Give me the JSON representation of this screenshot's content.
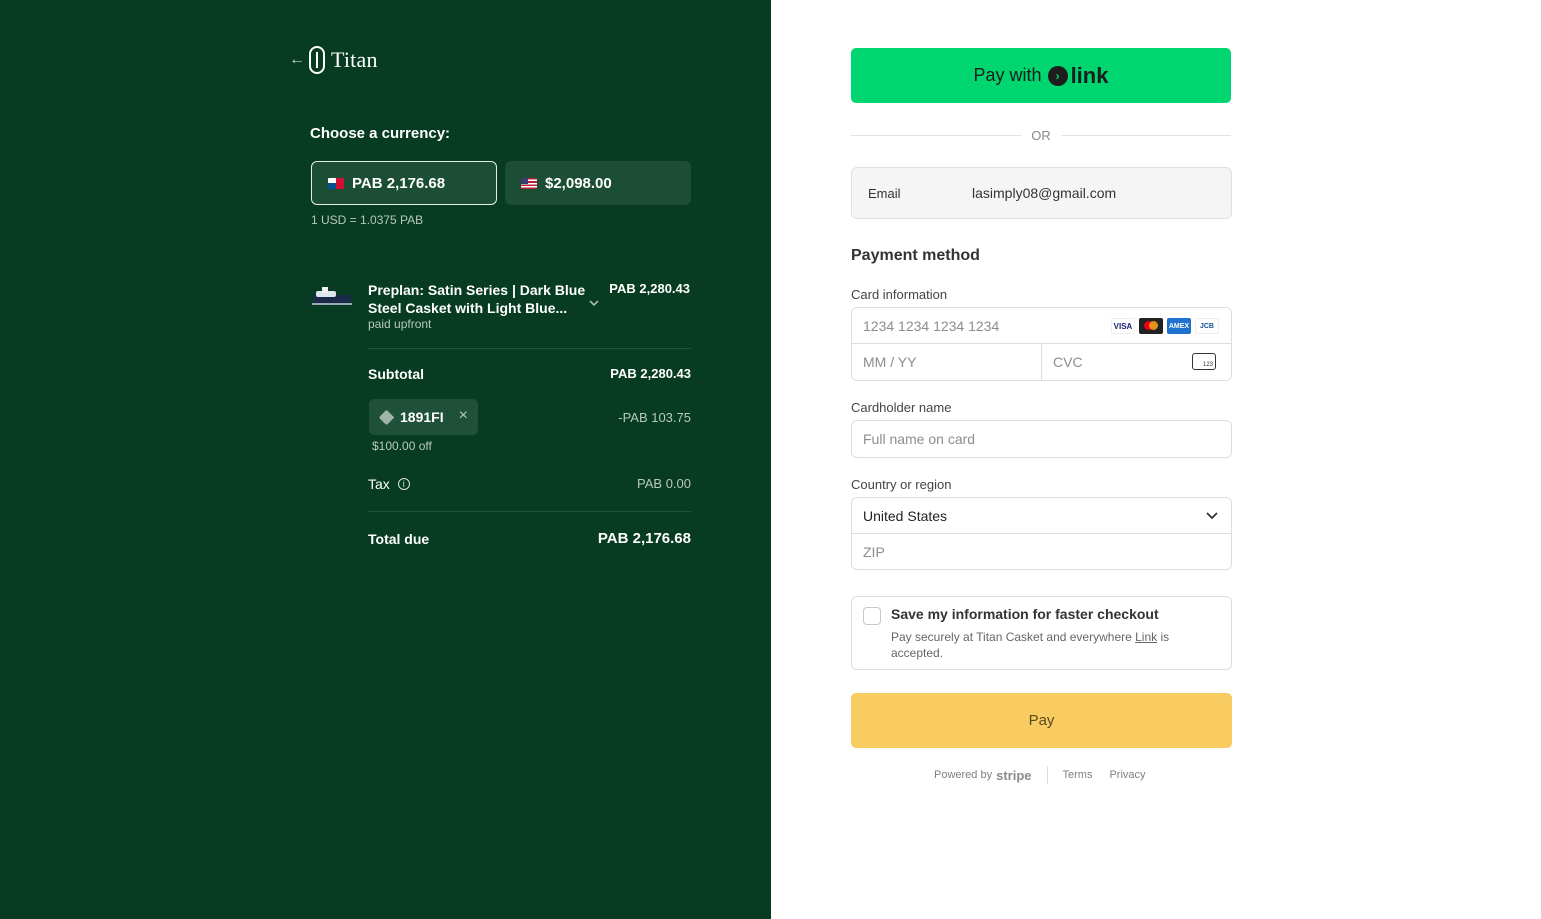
{
  "brand": {
    "name": "Titan",
    "back_icon": "arrow-left-icon",
    "logo_icon": "titan-logo-icon"
  },
  "currency": {
    "title": "Choose a currency:",
    "options": [
      {
        "label": "PAB 2,176.68",
        "flag": "panama-flag-icon",
        "selected": true
      },
      {
        "label": "$2,098.00",
        "flag": "us-flag-icon",
        "selected": false
      }
    ],
    "rate": "1 USD = 1.0375 PAB"
  },
  "item": {
    "title": "Preplan: Satin Series | Dark Blue Steel Casket with Light Blue...",
    "subtitle": "paid upfront",
    "price": "PAB 2,280.43"
  },
  "summary": {
    "subtotal_label": "Subtotal",
    "subtotal_value": "PAB 2,280.43",
    "promo_code": "1891FI",
    "promo_off": "$100.00 off",
    "discount_value": "-PAB 103.75",
    "tax_label": "Tax",
    "tax_value": "PAB 0.00",
    "total_label": "Total due",
    "total_value": "PAB 2,176.68"
  },
  "checkout": {
    "pay_with_label": "Pay with",
    "link_label": "link",
    "or_label": "OR",
    "email_label": "Email",
    "email_value": "lasimply08@gmail.com",
    "payment_method_title": "Payment method",
    "card_info_label": "Card information",
    "card_number_placeholder": "1234 1234 1234 1234",
    "expiry_placeholder": "MM / YY",
    "cvc_placeholder": "CVC",
    "cvc_icon_text": "123",
    "card_brands": [
      "VISA",
      "Mastercard",
      "AMEX",
      "JCB"
    ],
    "cardholder_label": "Cardholder name",
    "cardholder_placeholder": "Full name on card",
    "country_label": "Country or region",
    "country_value": "United States",
    "zip_placeholder": "ZIP",
    "save_title": "Save my information for faster checkout",
    "save_desc_before": "Pay securely at Titan Casket and everywhere ",
    "save_desc_link": "Link",
    "save_desc_after": " is accepted.",
    "pay_button": "Pay",
    "powered_by": "Powered by",
    "stripe": "stripe",
    "terms": "Terms",
    "privacy": "Privacy"
  },
  "colors": {
    "left_bg": "#073b22",
    "link_green": "#00d66f",
    "pay_yellow": "#f9cc61"
  }
}
